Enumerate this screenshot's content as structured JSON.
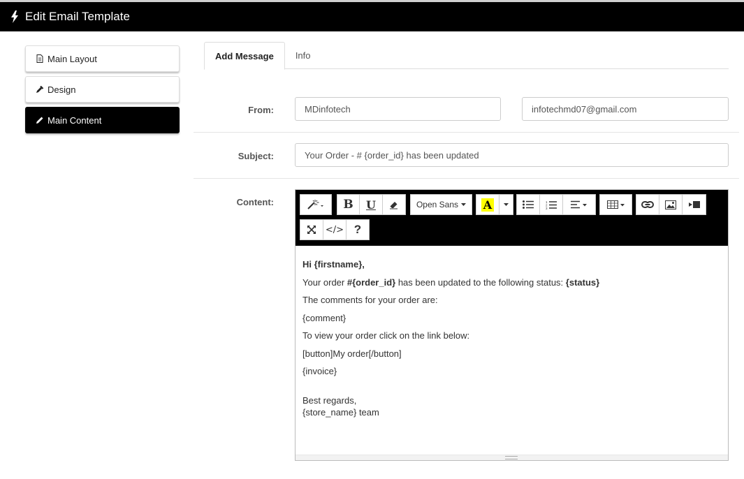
{
  "header": {
    "title": "Edit Email Template",
    "icon": "bolt-icon"
  },
  "sidebar": {
    "items": [
      {
        "label": "Main Layout",
        "icon": "file-icon",
        "active": false
      },
      {
        "label": "Design",
        "icon": "eyedropper-icon",
        "active": false
      },
      {
        "label": "Main Content",
        "icon": "pencil-icon",
        "active": true
      }
    ]
  },
  "tabs": [
    {
      "label": "Add Message",
      "active": true
    },
    {
      "label": "Info",
      "active": false
    }
  ],
  "form": {
    "from_label": "From:",
    "from_name": "MDinfotech",
    "from_email": "infotechmd07@gmail.com",
    "subject_label": "Subject:",
    "subject": "Your Order - # {order_id} has been updated",
    "content_label": "Content:"
  },
  "toolbar": {
    "font_name": "Open Sans",
    "highlight_letter": "A",
    "bold": "B",
    "underline": "U",
    "help": "?",
    "code": "</>",
    "highlight_color": "#ffff00"
  },
  "content": {
    "greeting": "Hi {firstname},",
    "line2_pre": "Your order ",
    "line2_bold1": "#{order_id}",
    "line2_mid": " has been updated to the following status: ",
    "line2_bold2": "{status}",
    "line3": "The comments for your order are:",
    "line4": "{comment}",
    "line5": "To view your order click on the link below:",
    "line6": "[button]My order[/button]",
    "line7": "{invoice}",
    "line8": "Best regards,",
    "line9": "{store_name} team"
  }
}
